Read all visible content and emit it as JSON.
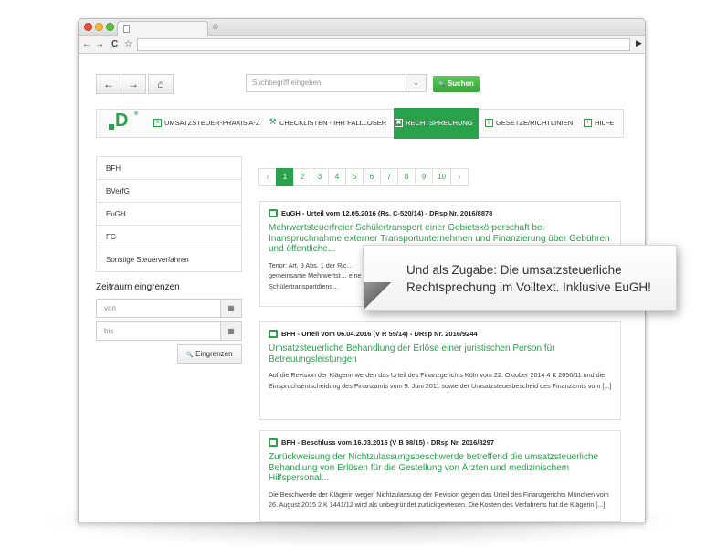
{
  "browser": {
    "tab_close": "⊗",
    "nav_back": "←",
    "nav_forward": "→",
    "reload": "C",
    "bookmark": "☆",
    "play": "▶"
  },
  "toolbar": {
    "back": "←",
    "forward": "→",
    "home": "⌂",
    "search_placeholder": "Suchbegriff eingeben",
    "search_caret": "⌄",
    "search_button": "Suchen",
    "search_icon": "🔍"
  },
  "nav": {
    "logo_letter": "D",
    "logo_reg": "®",
    "items": [
      {
        "label": "UMSATZSTEUER-PRAXIS A-Z",
        "icon": "list-icon"
      },
      {
        "label": "CHECKLISTEN - IHR FALLLOSER",
        "icon": "wrench-icon"
      },
      {
        "label": "RECHTSPRECHUNG",
        "icon": "gavel-icon",
        "active": true
      },
      {
        "label": "GESETZE/RICHTLINIEN",
        "icon": "paragraph-icon"
      },
      {
        "label": "HILFE",
        "icon": "info-icon"
      }
    ]
  },
  "sidebar": {
    "items": [
      "BFH",
      "BVerfG",
      "EuGH",
      "FG",
      "Sonstige Steuerverfahren"
    ],
    "zeitraum_title": "Zeitraum eingrenzen",
    "from_placeholder": "von",
    "to_placeholder": "bis",
    "calendar_glyph": "▦",
    "eingrenzen_label": "Eingrenzen",
    "eingrenzen_icon": "🔍"
  },
  "pagination": {
    "prev": "‹",
    "next": "›",
    "pages": [
      "1",
      "2",
      "3",
      "4",
      "5",
      "6",
      "7",
      "8",
      "9",
      "10"
    ],
    "current": "1"
  },
  "results": [
    {
      "head": "EuGH - Urteil vom 12.05.2016 (Rs. C-520/14) - DRsp Nr. 2016/8878",
      "title": "Mehrwertsteuerfreier Schülertransport einer Gebietskörperschaft bei Inanspruchnahme externer Transportunternehmen und Finanzierung über Gebühren und öffentliche...",
      "body": "Tenor: Art. 9 Abs. 1 der Ric… gemeinsame Mehrwertst… eine Schülertransportdiens…"
    },
    {
      "head": "BFH - Urteil vom 06.04.2016 (V R 55/14) - DRsp Nr. 2016/9244",
      "title": "Umsatzsteuerliche Behandlung der Erlöse einer juristischen Person für Betreuungsleistungen",
      "body": "Auf die Revision der Klägerin werden das Urteil des Finanzgerichts Köln vom 22. Oktober 2014 4 K 2056/11 und die Einspruchsentscheidung des Finanzamts vom 9. Juni 2011 sowie der Umsatzsteuerbescheid des Finanzamts vom [...]"
    },
    {
      "head": "BFH - Beschluss vom 16.03.2016 (V B 98/15) - DRsp Nr. 2016/8297",
      "title": "Zurückweisung der Nichtzulassungsbeschwerde betreffend die umsatzsteuerliche Behandlung von Erlösen für die Gestellung von Ärzten und medizinischem Hilfspersonal...",
      "body": "Die Beschwerde der Klägerin wegen Nichtzulassung der Revision gegen das Urteil des Finanzgerichts München vom 26. August 2015 2 K 1441/12 wird als unbegründet zurückgewiesen. Die Kosten des Verfahrens hat die Klägerin [...]"
    }
  ],
  "callout": {
    "text": "Und als Zugabe: Die umsatzsteuerliche Rechtsprechung im Volltext. Inklusive EuGH!"
  },
  "colors": {
    "accent": "#2aa14b"
  }
}
